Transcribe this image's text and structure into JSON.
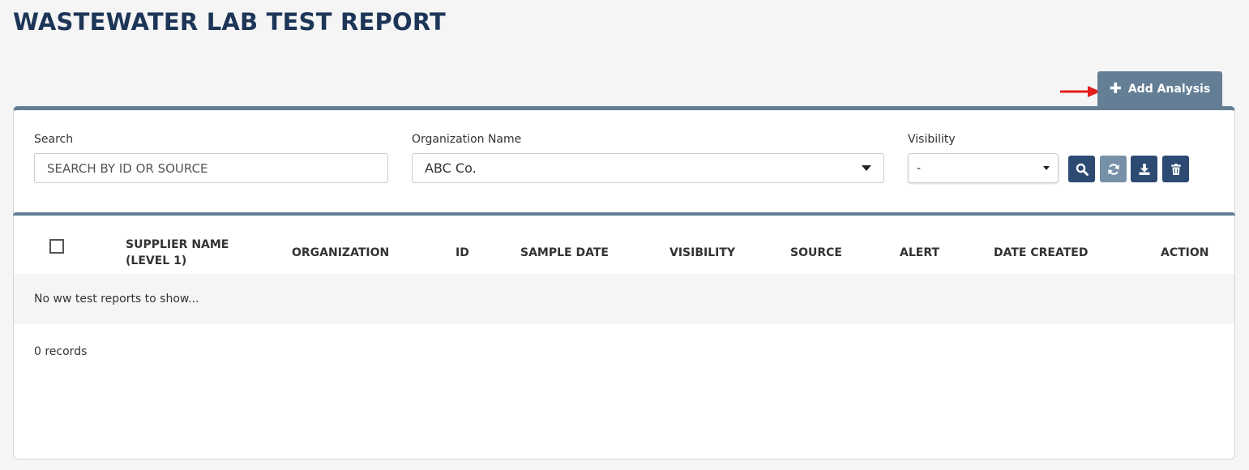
{
  "page": {
    "title": "WASTEWATER LAB TEST REPORT"
  },
  "actions": {
    "add_analysis_label": "Add Analysis"
  },
  "filters": {
    "search_label": "Search",
    "search_placeholder": "SEARCH BY ID OR SOURCE",
    "org_label": "Organization Name",
    "org_value": "ABC Co.",
    "visibility_label": "Visibility",
    "visibility_value": "-"
  },
  "toolbar_icons": [
    "search-icon",
    "refresh-icon",
    "download-icon",
    "trash-icon"
  ],
  "table": {
    "columns": [
      "SUPPLIER NAME",
      "(LEVEL 1)",
      "ORGANIZATION",
      "ID",
      "SAMPLE DATE",
      "VISIBILITY",
      "SOURCE",
      "ALERT",
      "DATE CREATED",
      "ACTION"
    ],
    "empty_message": "No ww test reports to show...",
    "records_text": "0 records"
  },
  "colors": {
    "title": "#1d3557",
    "accent": "#647e95",
    "button_dark": "#2d4a73",
    "button_light": "#7690a7",
    "arrow": "#e31d1d"
  }
}
